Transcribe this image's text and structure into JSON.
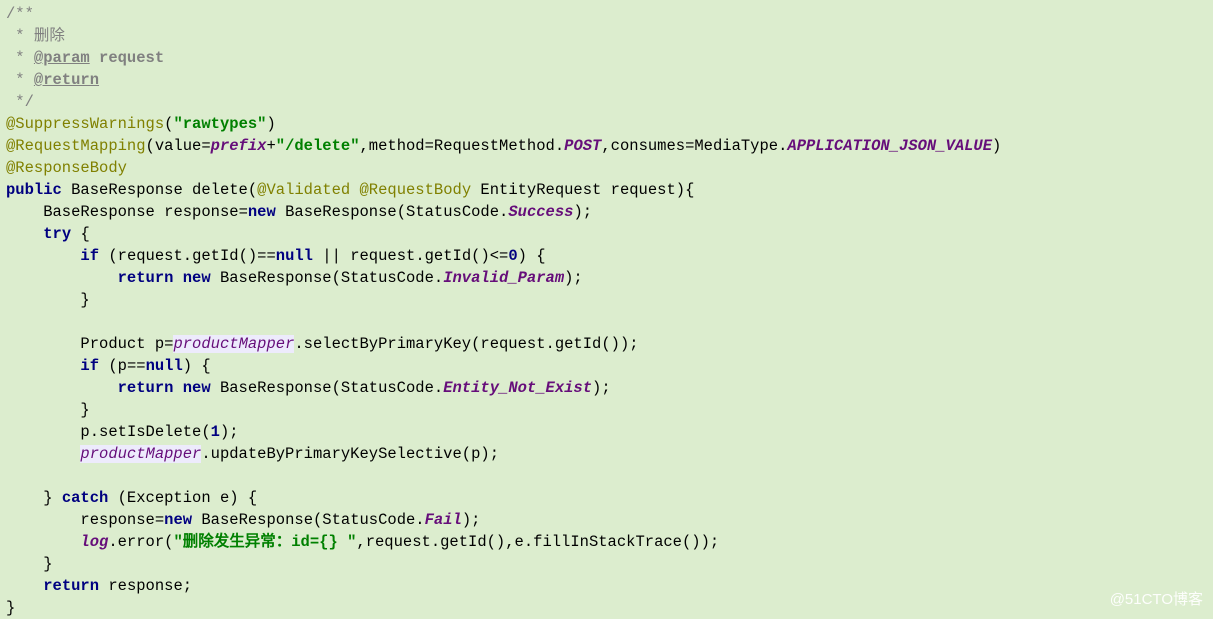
{
  "doc": {
    "c1": "/**",
    "c2": " * 删除",
    "c3_a": " * ",
    "c3_b": "@param",
    "c3_c": " request",
    "c4_a": " * ",
    "c4_b": "@return",
    "c5": " */"
  },
  "ann": {
    "sw1": "@SuppressWarnings",
    "sw2": "(",
    "sw3": "\"rawtypes\"",
    "sw4": ")",
    "rm1": "@RequestMapping",
    "rm2": "(value=",
    "rm3": "prefix",
    "rm4": "+",
    "rm5": "\"/delete\"",
    "rm6": ",method=RequestMethod.",
    "rm7": "POST",
    "rm8": ",consumes=MediaType.",
    "rm9": "APPLICATION_JSON_VALUE",
    "rm10": ")",
    "rb": "@ResponseBody",
    "val": "@Validated ",
    "reqb": "@RequestBody "
  },
  "sig": {
    "pub": "public ",
    "ret": "BaseResponse ",
    "name": "delete(",
    "ptype": "EntityRequest ",
    "pname": "request",
    "close": "){"
  },
  "l1": {
    "a": "    BaseResponse ",
    "b": "response",
    "c": "=",
    "d": "new ",
    "e": "BaseResponse(StatusCode.",
    "f": "Success",
    "g": ");"
  },
  "l2": {
    "a": "    ",
    "b": "try ",
    "c": "{"
  },
  "l3": {
    "a": "        ",
    "b": "if ",
    "c": "(",
    "d": "request",
    "e": ".getId()==",
    "f": "null ",
    "g": "|| ",
    "h": "request",
    "i": ".getId()<=",
    "j": "0",
    "k": ") {"
  },
  "l4": {
    "a": "            ",
    "b": "return new ",
    "c": "BaseResponse(StatusCode.",
    "d": "Invalid_Param",
    "e": ");"
  },
  "l5": "        }",
  "l6": "",
  "l7": {
    "a": "        Product ",
    "b": "p",
    "c": "=",
    "d": "productMapper",
    "e": ".selectByPrimaryKey(",
    "f": "request",
    "g": ".getId());"
  },
  "l8": {
    "a": "        ",
    "b": "if ",
    "c": "(",
    "d": "p",
    "e": "==",
    "f": "null",
    "g": ") {"
  },
  "l9": {
    "a": "            ",
    "b": "return new ",
    "c": "BaseResponse(StatusCode.",
    "d": "Entity_Not_Exist",
    "e": ");"
  },
  "l10": "        }",
  "l11": {
    "a": "        ",
    "b": "p",
    "c": ".setIsDelete(",
    "d": "1",
    "e": ");"
  },
  "l12": {
    "a": "        ",
    "b": "productMapper",
    "c": ".updateByPrimaryKeySelective(",
    "d": "p",
    "e": ");"
  },
  "l13": "",
  "l14": {
    "a": "    } ",
    "b": "catch ",
    "c": "(Exception ",
    "d": "e",
    "e": ") {"
  },
  "l15": {
    "a": "        ",
    "b": "response",
    "c": "=",
    "d": "new ",
    "e": "BaseResponse(StatusCode.",
    "f": "Fail",
    "g": ");"
  },
  "l16": {
    "a": "        ",
    "b": "log",
    "c": ".error(",
    "d": "\"删除发生异常：id={} \"",
    "e": ",",
    "f": "request",
    "g": ".getId(),",
    "h": "e",
    "i": ".fillInStackTrace());"
  },
  "l17": "    }",
  "l18": {
    "a": "    ",
    "b": "return ",
    "c": "response",
    "d": ";"
  },
  "l19": "}",
  "watermark": "@51CTO博客"
}
